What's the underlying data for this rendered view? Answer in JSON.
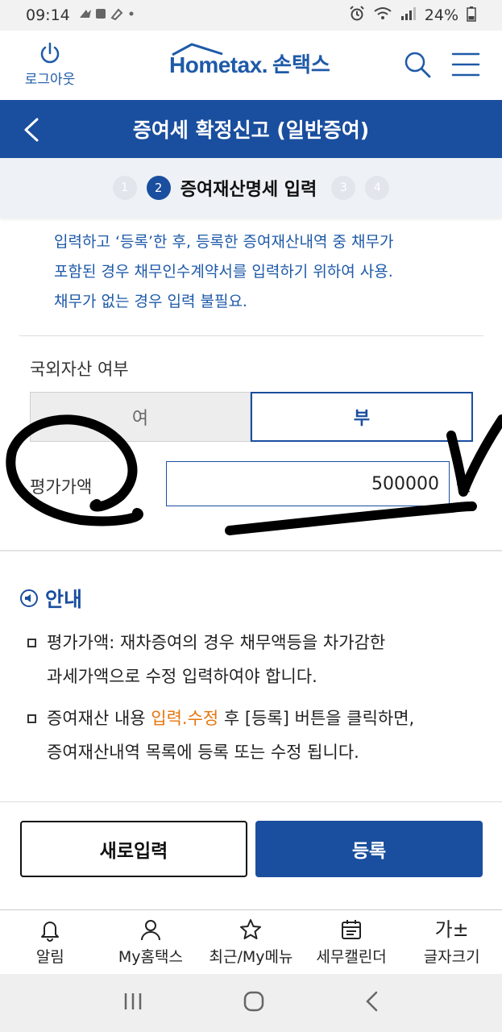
{
  "status": {
    "time": "09:14",
    "battery": "24%"
  },
  "header": {
    "logout_label": "로그아웃",
    "brand": "Hometax.",
    "brand_sub": "손택스"
  },
  "titlebar": {
    "title": "증여세 확정신고 (일반증여)"
  },
  "steps": {
    "items": [
      "1",
      "2",
      "3",
      "4"
    ],
    "active_label": "증여재산명세 입력"
  },
  "notice": {
    "lines": [
      "입력하고 ‘등록’한 후, 등록한 증여재산내역 중 채무가",
      "포함된 경우 채무인수계약서를 입력하기 위하여 사용.",
      "채무가 없는 경우 입력 불필요."
    ]
  },
  "form": {
    "foreign_label": "국외자산 여부",
    "foreign_yes": "여",
    "foreign_no": "부",
    "amount_label": "평가가액",
    "amount_value": "500000",
    "amount_unit": "원"
  },
  "guide": {
    "title": "안내",
    "bullet1_l1": "평가가액: 재차증여의 경우 채무액등을 차가감한",
    "bullet1_l2": "과세가액으로 수정 입력하여야 합니다.",
    "bullet2_pre": "증여재산 내용 ",
    "bullet2_hl": "입력.수정",
    "bullet2_post": " 후 [등록] 버튼을 클릭하면,",
    "bullet2_l2": "증여재산내역 목록에 등록 또는 수정 됩니다."
  },
  "buttons": {
    "reset": "새로입력",
    "submit": "등록"
  },
  "bottom_nav": {
    "alert": "알림",
    "my": "My홈택스",
    "recent": "최근/My메뉴",
    "calendar": "세무캘린더",
    "fontsize": "글자크기",
    "fontsize_glyph": "가±"
  },
  "colors": {
    "primary": "#1a4e9e",
    "accent": "#e8740c",
    "notice_text": "#1e5aa8"
  }
}
